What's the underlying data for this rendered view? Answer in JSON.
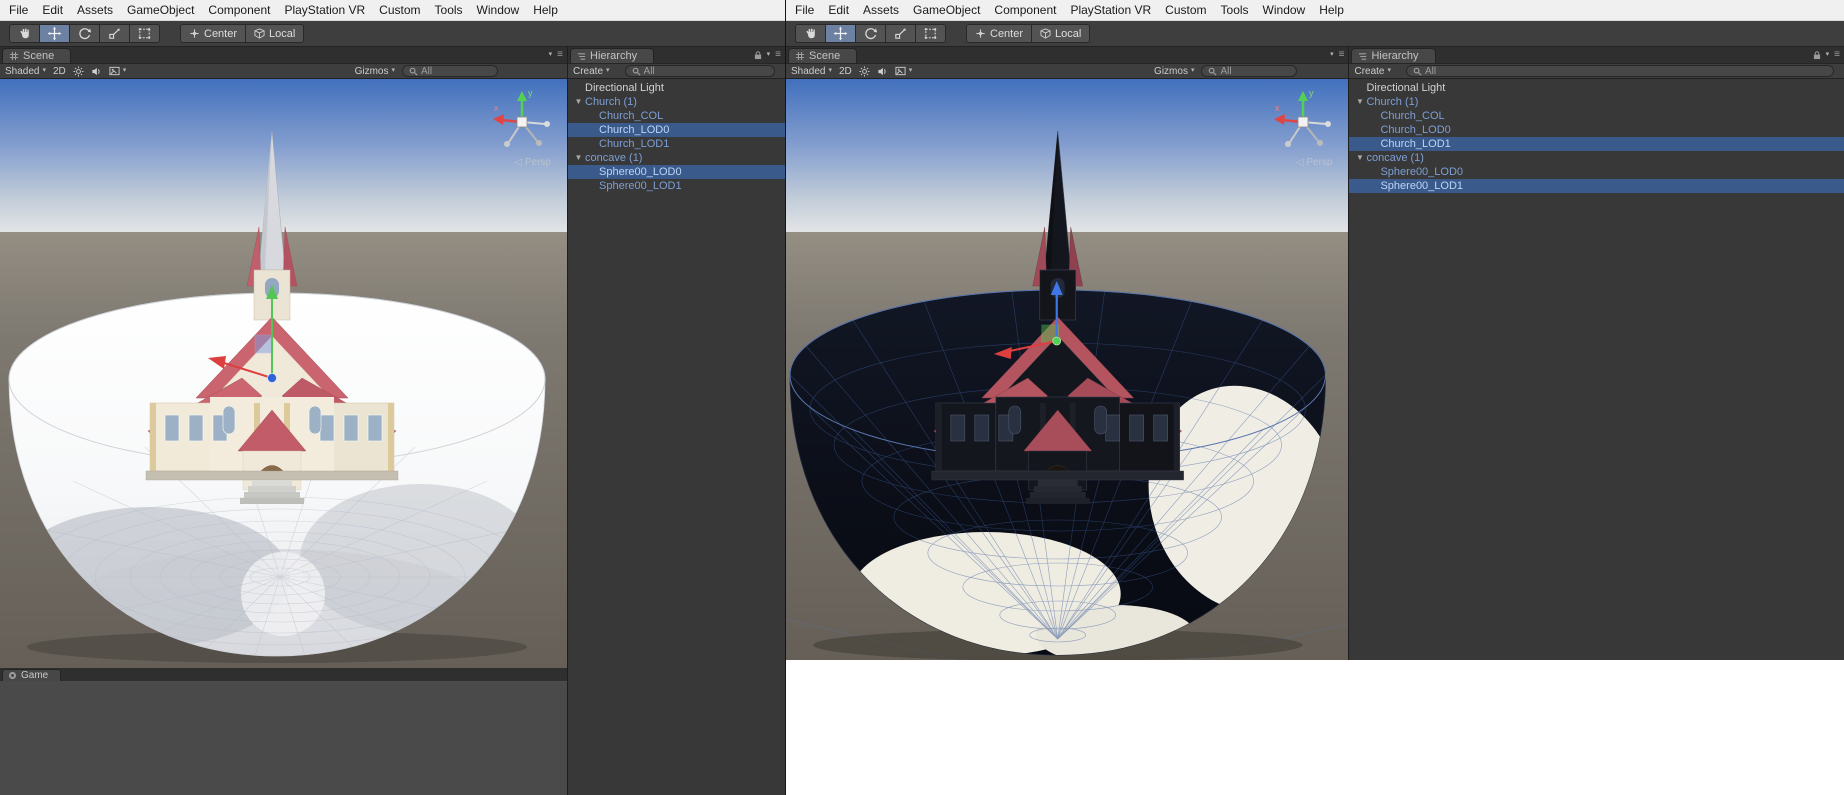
{
  "menu_items": [
    "File",
    "Edit",
    "Assets",
    "GameObject",
    "Component",
    "PlayStation VR",
    "Custom",
    "Tools",
    "Window",
    "Help"
  ],
  "toolbar": {
    "tools": [
      "pan-tool",
      "move-tool",
      "rotate-tool",
      "scale-tool",
      "rect-tool"
    ],
    "active_tool": "move-tool",
    "center_label": "Center",
    "local_label": "Local"
  },
  "scene_panel": {
    "tab": "Scene",
    "shading_mode": "Shaded",
    "mode_2d": "2D",
    "gizmos_label": "Gizmos",
    "search_value": "All",
    "persp_label": "Persp"
  },
  "game_panel": {
    "tab": "Game"
  },
  "hierarchy_panel": {
    "tab": "Hierarchy",
    "create_label": "Create",
    "search_value": "All"
  },
  "colors": {
    "selection_blue": "#3a5a8c",
    "prefab_text_blue": "#7d9fd6",
    "default_text": "#d2d2d2",
    "roof_red": "#ca6570",
    "sky_top_blue": "#4270bd"
  },
  "editors": [
    {
      "side": "left",
      "rows": [
        {
          "label": "Directional Light",
          "depth": 0,
          "expandable": false,
          "prefab": false,
          "selected": false
        },
        {
          "label": "Church (1)",
          "depth": 0,
          "expandable": true,
          "prefab": true,
          "selected": false
        },
        {
          "label": "Church_COL",
          "depth": 1,
          "expandable": false,
          "prefab": true,
          "selected": false
        },
        {
          "label": "Church_LOD0",
          "depth": 1,
          "expandable": false,
          "prefab": true,
          "selected": true
        },
        {
          "label": "Church_LOD1",
          "depth": 1,
          "expandable": false,
          "prefab": true,
          "selected": false
        },
        {
          "label": "concave (1)",
          "depth": 0,
          "expandable": true,
          "prefab": true,
          "selected": false
        },
        {
          "label": "Sphere00_LOD0",
          "depth": 1,
          "expandable": false,
          "prefab": true,
          "selected": true
        },
        {
          "label": "Sphere00_LOD1",
          "depth": 1,
          "expandable": false,
          "prefab": true,
          "selected": false
        }
      ]
    },
    {
      "side": "right",
      "rows": [
        {
          "label": "Directional Light",
          "depth": 0,
          "expandable": false,
          "prefab": false,
          "selected": false
        },
        {
          "label": "Church (1)",
          "depth": 0,
          "expandable": true,
          "prefab": true,
          "selected": false
        },
        {
          "label": "Church_COL",
          "depth": 1,
          "expandable": false,
          "prefab": true,
          "selected": false
        },
        {
          "label": "Church_LOD0",
          "depth": 1,
          "expandable": false,
          "prefab": true,
          "selected": false
        },
        {
          "label": "Church_LOD1",
          "depth": 1,
          "expandable": false,
          "prefab": true,
          "selected": true
        },
        {
          "label": "concave (1)",
          "depth": 0,
          "expandable": true,
          "prefab": true,
          "selected": false
        },
        {
          "label": "Sphere00_LOD0",
          "depth": 1,
          "expandable": false,
          "prefab": true,
          "selected": false
        },
        {
          "label": "Sphere00_LOD1",
          "depth": 1,
          "expandable": false,
          "prefab": true,
          "selected": true
        }
      ]
    }
  ]
}
